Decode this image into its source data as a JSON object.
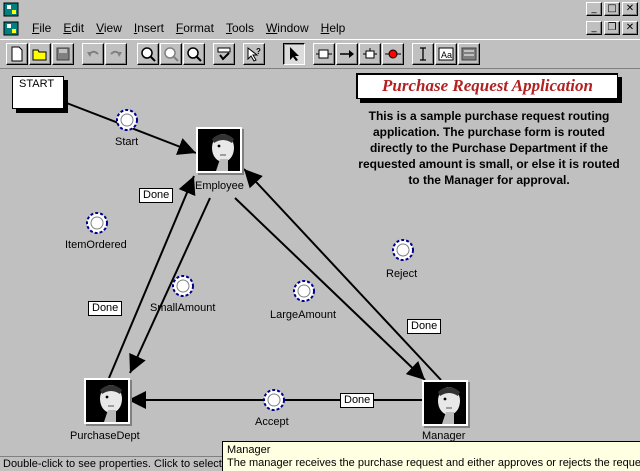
{
  "menu": {
    "items": [
      {
        "label": "File",
        "key": "F",
        "rest": "ile"
      },
      {
        "label": "Edit",
        "key": "E",
        "rest": "dit"
      },
      {
        "label": "View",
        "key": "V",
        "rest": "iew"
      },
      {
        "label": "Insert",
        "key": "I",
        "rest": "nsert"
      },
      {
        "label": "Format",
        "key": "F",
        "rest": "ormat"
      },
      {
        "label": "Tools",
        "key": "T",
        "rest": "ools"
      },
      {
        "label": "Window",
        "key": "W",
        "rest": "indow"
      },
      {
        "label": "Help",
        "key": "H",
        "rest": "elp"
      }
    ]
  },
  "diagram": {
    "title": "Purchase Request Application",
    "description": "This is a sample purchase request routing application. The purchase form is routed directly to the Purchase Department if the requested amount is small, or else it is routed to the Manager for approval.",
    "start_label": "START",
    "nodes": {
      "employee": "Employee",
      "purchasedept": "PurchaseDept",
      "manager": "Manager"
    },
    "events": {
      "start": "Start",
      "itemordered": "ItemOrdered",
      "smallamount": "SmallAmount",
      "largeamount": "LargeAmount",
      "reject": "Reject",
      "accept": "Accept"
    },
    "done_label": "Done"
  },
  "status": {
    "text": "Double-click to see properties. Click to select."
  },
  "tooltip": {
    "title": "Manager",
    "text": "The manager receives the purchase request and either approves or rejects the request."
  }
}
